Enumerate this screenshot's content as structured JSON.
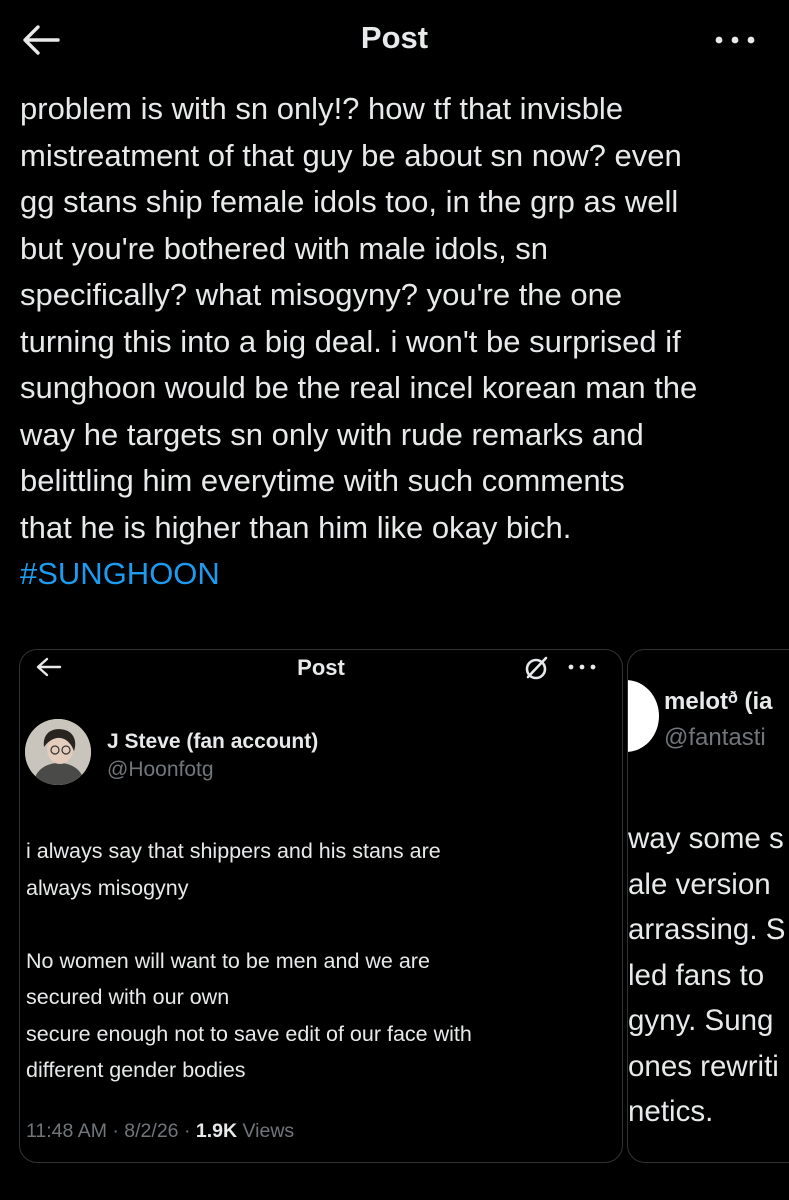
{
  "header": {
    "title": "Post",
    "back_icon": "arrow-left-icon",
    "more_icon": "more-horizontal-icon"
  },
  "post": {
    "text": "problem is with sn only!? how tf that invisble\nmistreatment of that guy be about sn now? even\ngg stans ship female idols too, in the grp as well\nbut you're bothered with male idols, sn\nspecifically? what misogyny? you're the one\nturning this into a big deal. i won't be surprised if\nsunghoon would be the real incel korean man the\nway he targets sn only with rude remarks and\nbelittling him everytime with such comments\nthat he is higher than him like okay bich.",
    "hashtag": "#SUNGHOON",
    "hashtag_color": "#1d9bf0"
  },
  "screenshot_card_1": {
    "header_title": "Post",
    "author_name": "J Steve (fan account)",
    "author_handle": "@Hoonfotg",
    "text": "i always say that shippers and his stans are\nalways misogyny\n\nNo women will want to be men and we are\nsecured with our own\nsecure enough not to save edit of our face with\ndifferent gender bodies",
    "time": "11:48 AM",
    "date": "8/2/26",
    "views_count": "1.9K",
    "views_label": "Views",
    "separator": "·"
  },
  "screenshot_card_2": {
    "author_name": "melotᶞ (ia",
    "author_handle": "@fantasti",
    "text": "way some s\nale version \narrassing. S\nled fans to\ngyny. Sung\nones rewriti\nnetics."
  },
  "colors": {
    "background": "#000000",
    "text": "#e7e9ea",
    "secondary_text": "#71767b",
    "border": "#2f3336",
    "accent": "#1d9bf0"
  }
}
